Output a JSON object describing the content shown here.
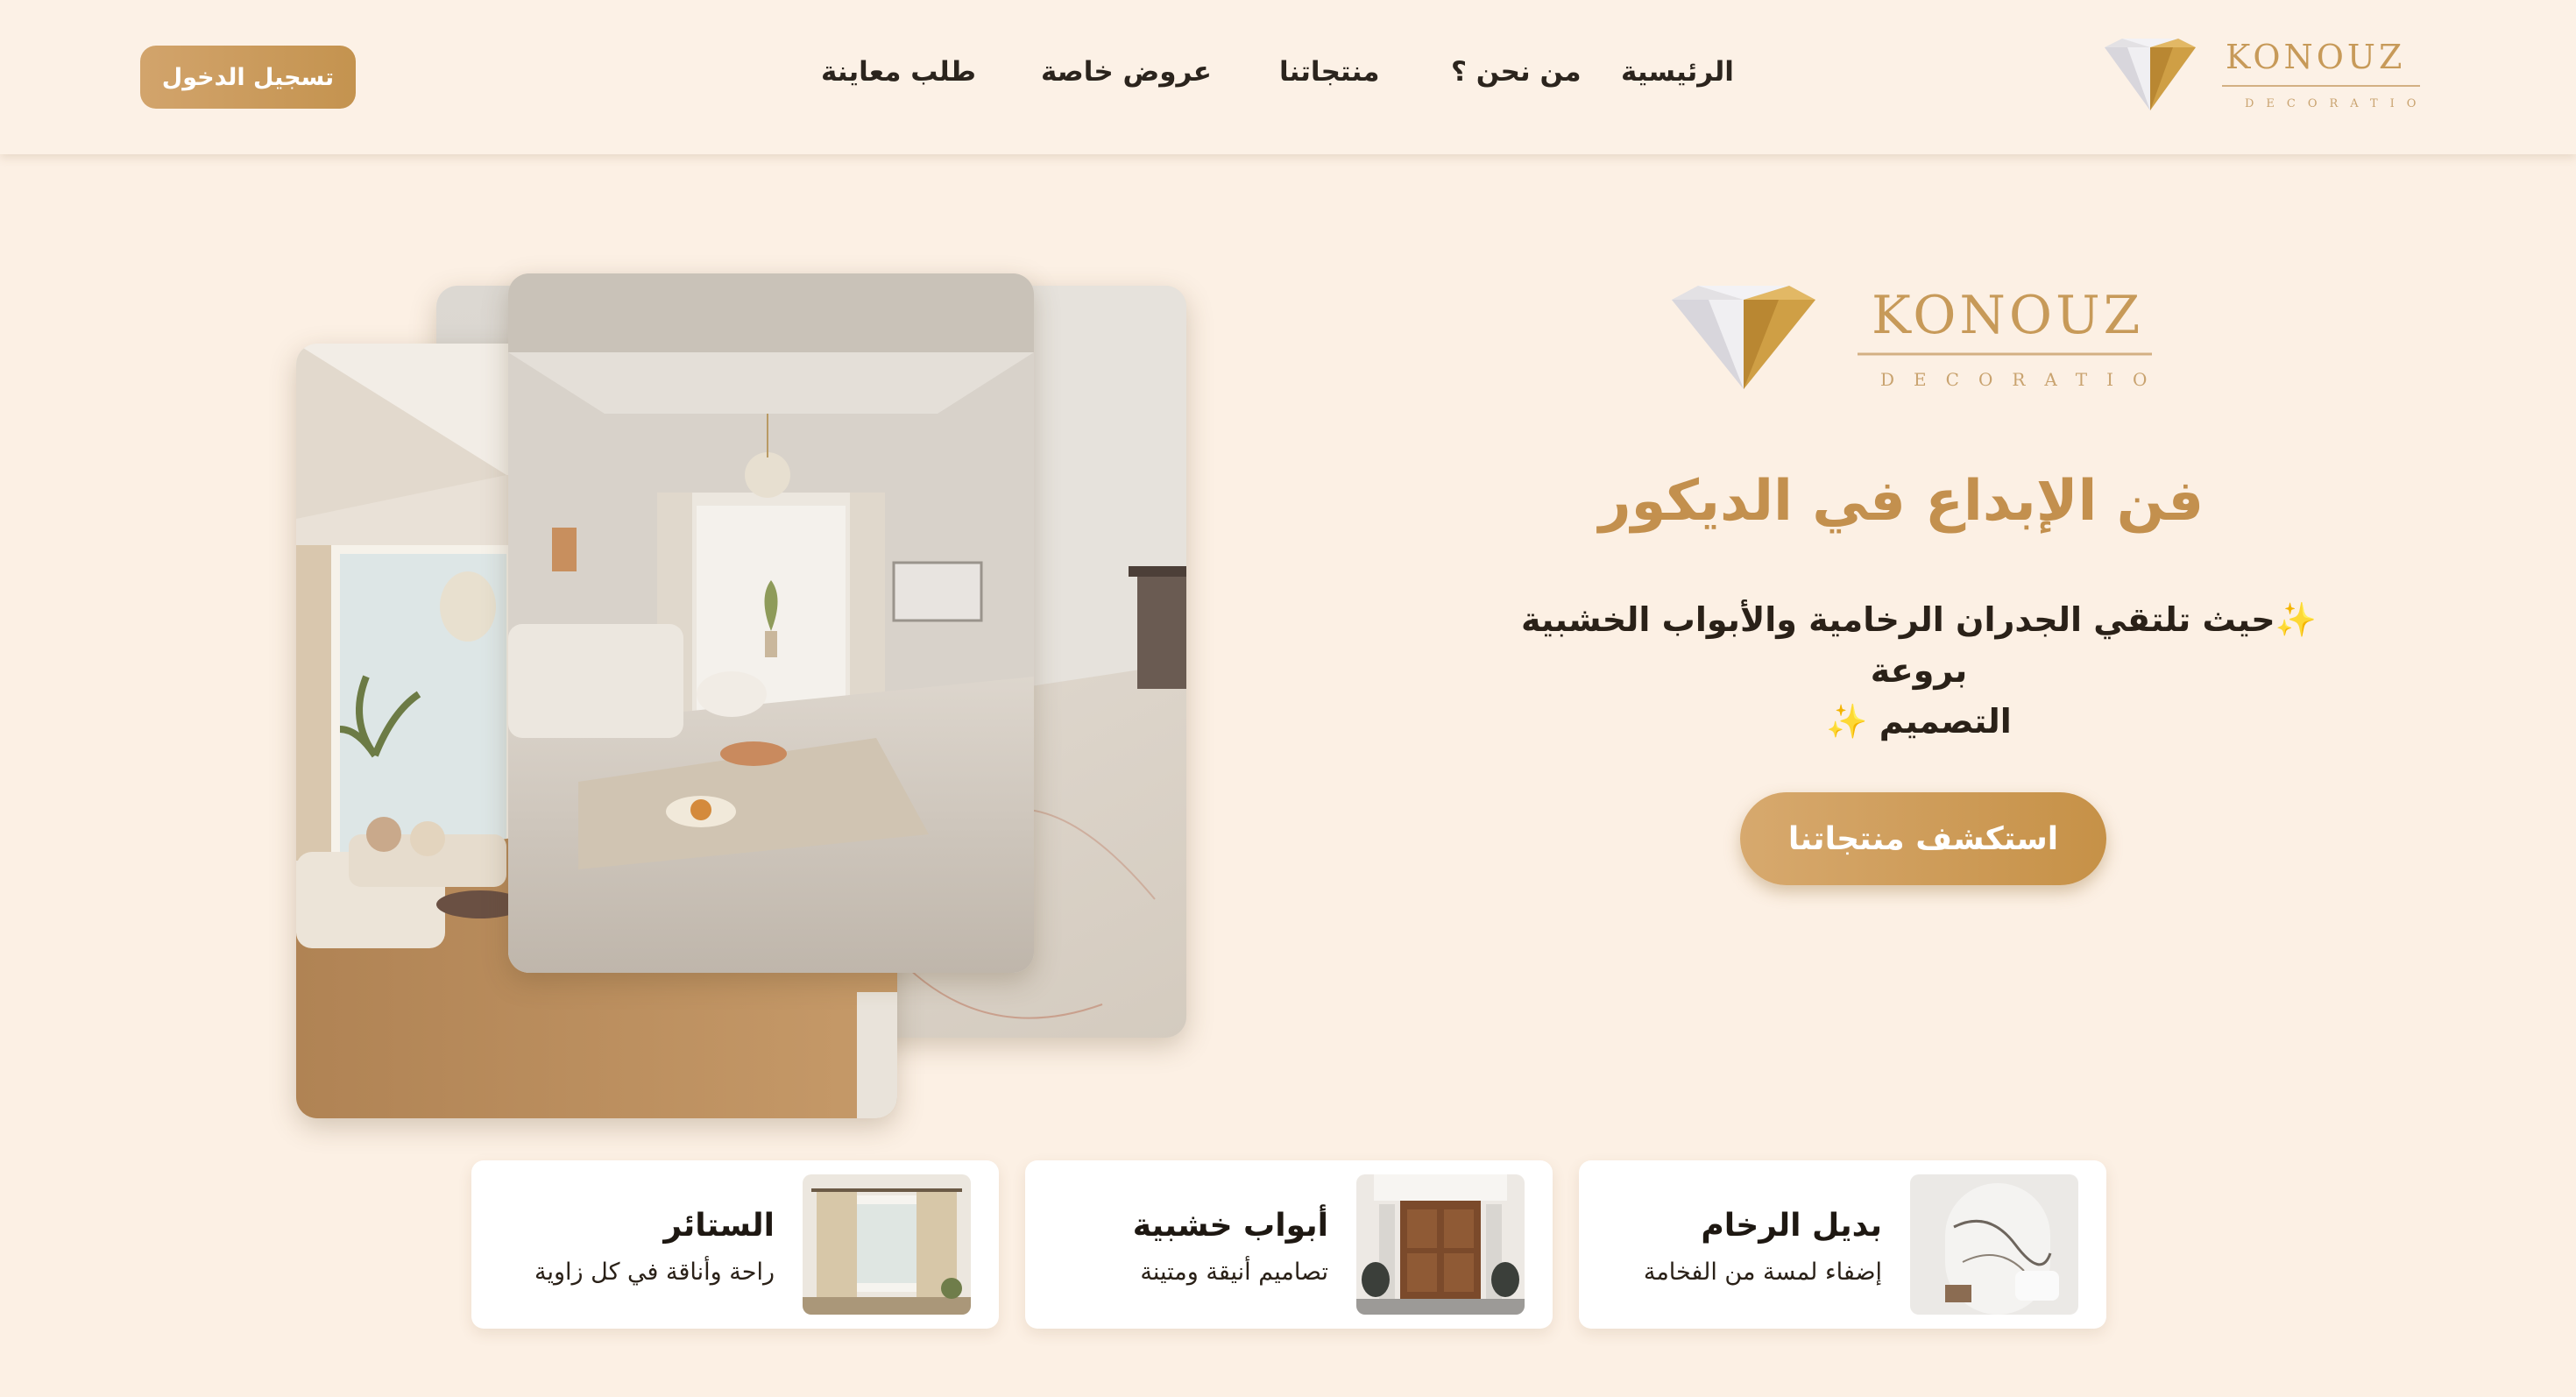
{
  "nav": {
    "login_label": "تسجيل الدخول",
    "items": [
      {
        "label": "الرئيسية"
      },
      {
        "label": "من نحن ؟"
      },
      {
        "label": "منتجاتنا"
      },
      {
        "label": "عروض خاصة"
      },
      {
        "label": "طلب معاينة"
      }
    ]
  },
  "brand": {
    "name": "KONOUZ",
    "tagline": "DECORATION"
  },
  "hero": {
    "title": "فن الإبداع في الديكور",
    "subtitle_line1": "حيث تلتقي الجدران الرخامية والأبواب الخشبية بروعة",
    "subtitle_line2": "التصميم",
    "sparkle": "✨",
    "cta_label": "استكشف منتجاتنا"
  },
  "features": [
    {
      "title": "بديل الرخام",
      "description": "إضفاء لمسة من الفخامة"
    },
    {
      "title": "أبواب خشبية",
      "description": "تصاميم أنيقة ومتينة"
    },
    {
      "title": "الستائر",
      "description": "راحة وأناقة في كل زاوية"
    }
  ],
  "colors": {
    "background": "#fcf0e4",
    "accent_gold": "#c79a59",
    "text_dark": "#2a2118",
    "card_bg": "#ffffff"
  },
  "icons": [
    "diamond-logo-icon"
  ]
}
